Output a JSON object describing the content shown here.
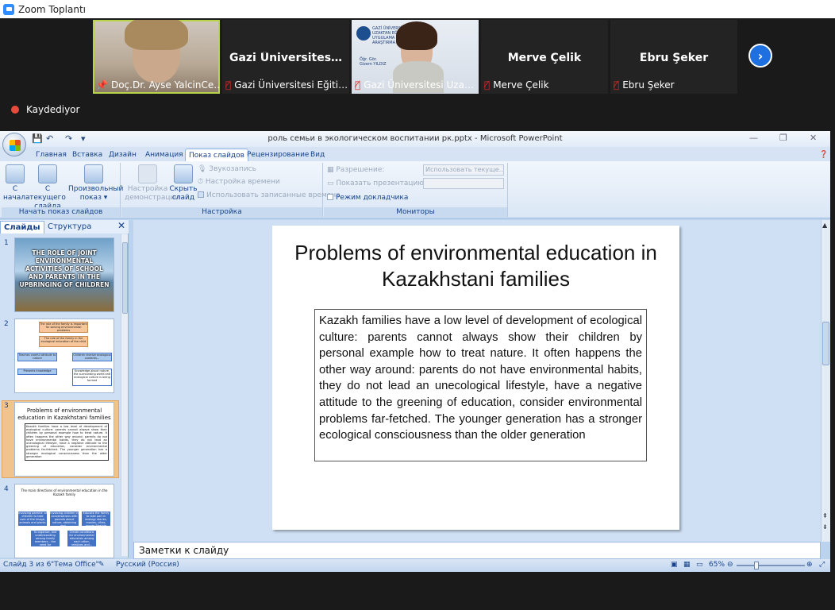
{
  "zoom": {
    "window_title": "Zoom Toplantı",
    "recording_label": "Kaydediyor",
    "participants": [
      {
        "label": "Doç.Dr. Ayse YalcinCe…",
        "name": "",
        "video": true
      },
      {
        "label": "Gazi Üniversitesi Eğiti…",
        "name": "Gazi  Üniversites…",
        "video": false
      },
      {
        "label": "Gazi Üniversitesi Uza…",
        "name": "",
        "video": true,
        "sign_lines": [
          "GAZİ ÜNİVERSİTESİ",
          "UZAKTAN EĞİTİM",
          "UYGULAMA VE",
          "ARAŞTIRMA MERKEZİ"
        ],
        "caption_lines": [
          "Öğr. Gör.",
          "Gizem YILDIZ"
        ]
      },
      {
        "label": "Merve Çelik",
        "name": "Merve Çelik",
        "video": false
      },
      {
        "label": "Ebru Şeker",
        "name": "Ebru Şeker",
        "video": false
      }
    ]
  },
  "ppt": {
    "title": "роль семьи в экологическом воспитании рк.pptx - Microsoft PowerPoint",
    "tabs": [
      "Главная",
      "Вставка",
      "Дизайн",
      "Анимация",
      "Показ слайдов",
      "Рецензирование",
      "Вид"
    ],
    "selected_tab": "Показ слайдов",
    "ribbon": {
      "from_start": [
        "С",
        "начала"
      ],
      "from_current": [
        "С текущего",
        "слайда"
      ],
      "custom_show": [
        "Произвольный",
        "показ ▾"
      ],
      "group_start": "Начать показ слайдов",
      "setup_show": [
        "Настройка",
        "демонстрации"
      ],
      "hide_slide": [
        "Скрыть",
        "слайд"
      ],
      "record_narration": "Звукозапись",
      "rehearse_timings": "Настройка времени",
      "use_timings": "Использовать записанные времена",
      "group_setup": "Настройка",
      "resolution_label": "Разрешение:",
      "resolution_value": "Использовать текуще…",
      "show_on_label": "Показать презентацию на:",
      "presenter_view": "Режим докладчика",
      "group_monitors": "Мониторы"
    },
    "side_tabs": [
      "Слайды",
      "Структура"
    ],
    "slides_panel": [
      {
        "num": "1",
        "title": "THE ROLE  OF JOINT ENVIRONMENTAL  ACTIVITIES  OF SCHOOL AND PARENTS  IN THE UPBRINGING  OF CHILDREN"
      },
      {
        "num": "2",
        "boxes": [
          "The role of the family is important for solving environmental problems",
          "The role of the family in the ecological education of the child",
          "Teaches careful attitude to nature",
          "Children receive ecological contents...",
          "Presents knowledge",
          "Knowledge about nature, the surrounding world and ecological culture is being formed"
        ]
      },
      {
        "num": "3",
        "title": "Problems of environmental education in Kazakhstani families"
      },
      {
        "num": "4",
        "title": "The main directions of environmental education in the Kazakh family",
        "boxes": [
          "Involving parents' of children to take care of the image, animals and plants",
          "Involving children in conversations with parents about nature, obtaining and...",
          "Educate the family to take part in ecology stories, movies, cities, proper lifestyle",
          "To organize, and understanding among family members – the need for environmental responsibility",
          "Create conditions for environmental education among each other, relatives and..."
        ]
      }
    ],
    "current_slide": {
      "title": "Problems of environmental education in Kazakhstani families",
      "body": "Kazakh families have a low level of development of ecological culture: parents cannot always show their children by personal example how to treat nature. It often happens the other way around: parents do not have environmental habits, they do not lead an unecological lifestyle, have a negative attitude to the greening of education, consider environmental problems far-fetched. The younger generation has a stronger ecological consciousness than the older generation"
    },
    "notes_placeholder": "Заметки к слайду",
    "status": {
      "slide_info": "Слайд 3 из 6",
      "theme": "\"Тема Office\"",
      "language": "Русский (Россия)",
      "zoom": "65%"
    }
  }
}
